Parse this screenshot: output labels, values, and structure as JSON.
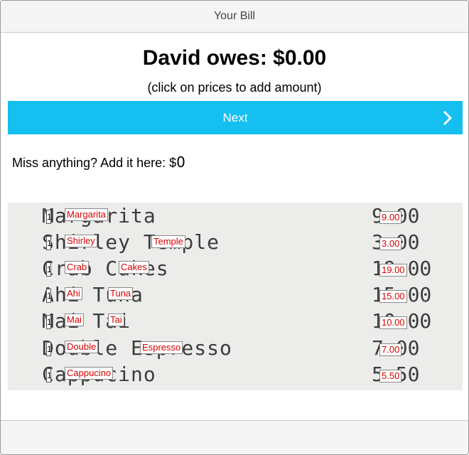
{
  "header": {
    "title": "Your Bill"
  },
  "summary": {
    "owes": "David owes: $0.00",
    "hint": "(click on prices to add amount)"
  },
  "next_button": {
    "label": "Next"
  },
  "add_missing": {
    "label": "Miss anything? Add it here: $",
    "value": "0"
  },
  "receipt": {
    "rows": [
      {
        "qty": "1",
        "text": "Margarita",
        "words": [
          "Margarita"
        ],
        "price_bg": "9.00",
        "price": "9.00"
      },
      {
        "qty": "1",
        "text": "Shirley Temple",
        "words": [
          "Shirley",
          "Temple"
        ],
        "price_bg": "3.00",
        "price": "3.00"
      },
      {
        "qty": "1",
        "text": "Crab Cakes",
        "words": [
          "Crab",
          "Cakes"
        ],
        "price_bg": "19.00",
        "price": "19.00"
      },
      {
        "qty": "1",
        "text": "Ahi Tuna",
        "words": [
          "Ahi",
          "Tuna"
        ],
        "price_bg": "15.00",
        "price": "15.00"
      },
      {
        "qty": "1",
        "text": "Mai Tai",
        "words": [
          "Mai",
          "Tai"
        ],
        "price_bg": "10.00",
        "price": "10.00"
      },
      {
        "qty": "1",
        "text": "Double Espresso",
        "words": [
          "Double",
          "Espresso"
        ],
        "price_bg": "7.00",
        "price": "7.00"
      },
      {
        "qty": "1",
        "text": "Cappucino",
        "words": [
          "Cappucino"
        ],
        "price_bg": "5.50",
        "price": "5.50"
      }
    ]
  },
  "colors": {
    "accent": "#15bfef",
    "price_text": "#d40000"
  }
}
